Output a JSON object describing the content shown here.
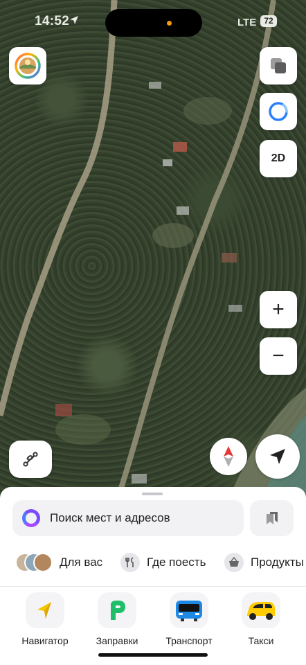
{
  "status_bar": {
    "time": "14:52",
    "network": "LTE",
    "battery": "72"
  },
  "map": {
    "mode_toggle_label": "2D",
    "zoom_in_label": "+",
    "zoom_out_label": "−"
  },
  "search": {
    "placeholder": "Поиск мест и адресов"
  },
  "chips": [
    {
      "label": "Для вас",
      "icon": "for-you-icon"
    },
    {
      "label": "Где поесть",
      "icon": "fork-knife-icon"
    },
    {
      "label": "Продукты",
      "icon": "basket-icon"
    }
  ],
  "tabs": [
    {
      "label": "Навигатор",
      "icon": "navigator-arrow-icon"
    },
    {
      "label": "Заправки",
      "icon": "fuel-p-icon"
    },
    {
      "label": "Транспорт",
      "icon": "bus-icon"
    },
    {
      "label": "Такси",
      "icon": "taxi-car-icon"
    }
  ],
  "colors": {
    "accent_purple": "#7b4cff",
    "navigator_yellow": "#f5c400",
    "fuel_green": "#1fbf6a",
    "transport_blue": "#1e88e5",
    "taxi_yellow": "#ffcc00",
    "compass_red": "#e53935",
    "alice_blue": "#2a7fff"
  }
}
